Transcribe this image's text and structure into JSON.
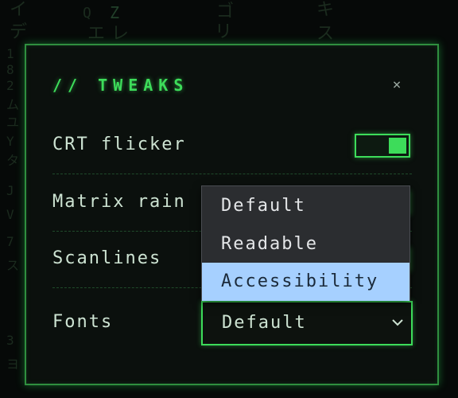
{
  "background_glyphs": [
    "イ",
    "Q",
    "Z",
    "ゴ",
    "キ",
    "デ",
    "エ",
    "レ",
    "リ",
    "ス",
    "1",
    "8",
    "2",
    "ム",
    "ユ",
    "Y",
    "タ",
    "J",
    "V",
    "7",
    "ス",
    "3",
    "ヨ"
  ],
  "panel": {
    "title": "// TWEAKS",
    "close_glyph": "×"
  },
  "settings": {
    "crt_flicker": {
      "label": "CRT flicker",
      "enabled": true
    },
    "matrix_rain": {
      "label": "Matrix rain",
      "enabled": true
    },
    "scanlines": {
      "label": "Scanlines",
      "enabled": true
    },
    "fonts": {
      "label": "Fonts",
      "value": "Default"
    }
  },
  "fonts_dropdown": {
    "options": [
      "Default",
      "Readable",
      "Accessibility"
    ],
    "highlighted": "Accessibility"
  },
  "colors": {
    "accent": "#3ddc5a",
    "panel_bg": "#0b100d",
    "menu_bg": "#2b2d30",
    "menu_highlight": "#a6d0ff"
  },
  "icons": {
    "close": "close-icon",
    "select_arrow": "chevron-down-icon"
  }
}
